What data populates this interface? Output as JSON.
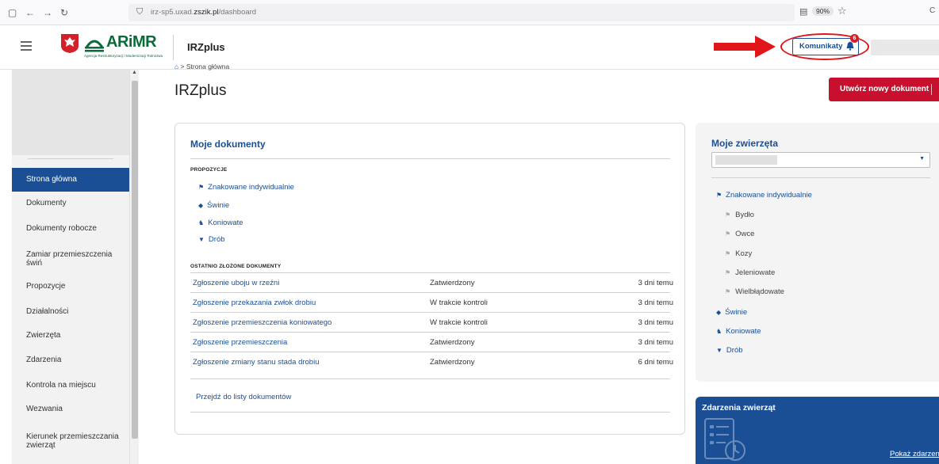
{
  "browser": {
    "url_prefix": "irz-sp5.uxad.",
    "url_domain": "zszik.pl",
    "url_path": "/dashboard",
    "zoom": "90%",
    "icons": [
      "sidebar-toggle-icon",
      "back-icon",
      "forward-icon",
      "reload-icon",
      "shield-icon",
      "reader-view-icon",
      "star-icon"
    ]
  },
  "header": {
    "logo_text": "ARiMR",
    "logo_subtitle": "Agencja Restrukturyzacji i Modernizacji Rolnictwa",
    "app_name": "IRZplus",
    "messages_button": "Komunikaty",
    "messages_count": "6"
  },
  "sidebar": {
    "items": [
      {
        "label": "Strona główna",
        "active": true
      },
      {
        "label": "Dokumenty"
      },
      {
        "label": "Dokumenty robocze"
      },
      {
        "label": "Zamiar przemieszczenia świń"
      },
      {
        "label": "Propozycje"
      },
      {
        "label": "Działalności"
      },
      {
        "label": "Zwierzęta"
      },
      {
        "label": "Zdarzenia"
      },
      {
        "label": "Kontrola na miejscu"
      },
      {
        "label": "Wezwania"
      },
      {
        "label": "Kierunek przemieszczania zwierząt"
      }
    ]
  },
  "main": {
    "breadcrumb": "Strona główna",
    "title": "IRZplus",
    "new_document_button": "Utwórz nowy dokument"
  },
  "documents": {
    "title": "Moje dokumenty",
    "proposals_label": "PROPOZYCJE",
    "proposals": [
      {
        "label": "Znakowane indywidualnie",
        "icon": "cattle-icon"
      },
      {
        "label": "Świnie",
        "icon": "pig-icon"
      },
      {
        "label": "Koniowate",
        "icon": "horse-icon"
      },
      {
        "label": "Drób",
        "icon": "poultry-icon"
      }
    ],
    "recent_label": "OSTATNIO ZŁOŻONE DOKUMENTY",
    "recent": [
      {
        "name": "Zgłoszenie uboju w rzeźni",
        "status": "Zatwierdzony",
        "time": "3 dni temu"
      },
      {
        "name": "Zgłoszenie przekazania zwłok drobiu",
        "status": "W trakcie kontroli",
        "time": "3 dni temu"
      },
      {
        "name": "Zgłoszenie przemieszczenia koniowatego",
        "status": "W trakcie kontroli",
        "time": "3 dni temu"
      },
      {
        "name": "Zgłoszenie przemieszczenia",
        "status": "Zatwierdzony",
        "time": "3 dni temu"
      },
      {
        "name": "Zgłoszenie zmiany stanu stada drobiu",
        "status": "Zatwierdzony",
        "time": "6 dni temu"
      }
    ],
    "all_link": "Przejdź do listy dokumentów"
  },
  "animals": {
    "title": "Moje zwierzęta",
    "group": "Znakowane indywidualnie",
    "subitems": [
      "Bydło",
      "Owce",
      "Kozy",
      "Jeleniowate",
      "Wielbłądowate"
    ],
    "others": [
      "Świnie",
      "Koniowate",
      "Drób"
    ]
  },
  "events": {
    "title": "Zdarzenia zwierząt",
    "link": "Pokaż zdarzenia"
  },
  "colors": {
    "primary": "#1a4f96",
    "danger": "#c8102e",
    "highlight": "#e0161b",
    "logo_green": "#0a6b3a"
  }
}
